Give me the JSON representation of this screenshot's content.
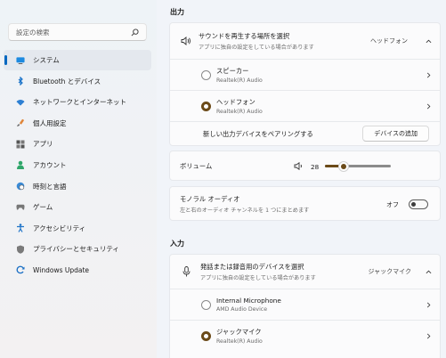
{
  "sidebar": {
    "search_placeholder": "設定の検索",
    "items": [
      {
        "label": "システム",
        "icon": "monitor-icon",
        "selected": true
      },
      {
        "label": "Bluetooth とデバイス",
        "icon": "bluetooth-icon"
      },
      {
        "label": "ネットワークとインターネット",
        "icon": "wifi-icon"
      },
      {
        "label": "個人用設定",
        "icon": "paintbrush-icon"
      },
      {
        "label": "アプリ",
        "icon": "apps-icon"
      },
      {
        "label": "アカウント",
        "icon": "person-icon"
      },
      {
        "label": "時刻と言語",
        "icon": "globe-clock-icon"
      },
      {
        "label": "ゲーム",
        "icon": "gamepad-icon"
      },
      {
        "label": "アクセシビリティ",
        "icon": "accessibility-icon"
      },
      {
        "label": "プライバシーとセキュリティ",
        "icon": "shield-icon"
      },
      {
        "label": "Windows Update",
        "icon": "update-icon"
      }
    ]
  },
  "output": {
    "title": "出力",
    "select": {
      "title": "サウンドを再生する場所を選択",
      "subtitle": "アプリに独自の設定をしている場合があります",
      "value": "ヘッドフォン"
    },
    "devices": [
      {
        "name": "スピーカー",
        "sub": "Realtek(R) Audio",
        "selected": false
      },
      {
        "name": "ヘッドフォン",
        "sub": "Realtek(R) Audio",
        "selected": true
      }
    ],
    "pair_label": "新しい出力デバイスをペアリングする",
    "add_button": "デバイスの追加",
    "volume_label": "ボリューム",
    "volume_value": "28",
    "volume_fraction": 0.28,
    "mono_title": "モノラル オーディオ",
    "mono_sub": "左と右のオーディオ チャンネルを 1 つにまとめます",
    "mono_state": "オフ"
  },
  "input": {
    "title": "入力",
    "select": {
      "title": "発話または録音用のデバイスを選択",
      "subtitle": "アプリに独自の設定をしている場合があります",
      "value": "ジャックマイク"
    },
    "devices": [
      {
        "name": "Internal Microphone",
        "sub": "AMD Audio Device",
        "selected": false
      },
      {
        "name": "ジャックマイク",
        "sub": "Realtek(R) Audio",
        "selected": true
      }
    ]
  },
  "colors": {
    "accent": "#0067c0",
    "selected_radio": "#6b4a18"
  }
}
